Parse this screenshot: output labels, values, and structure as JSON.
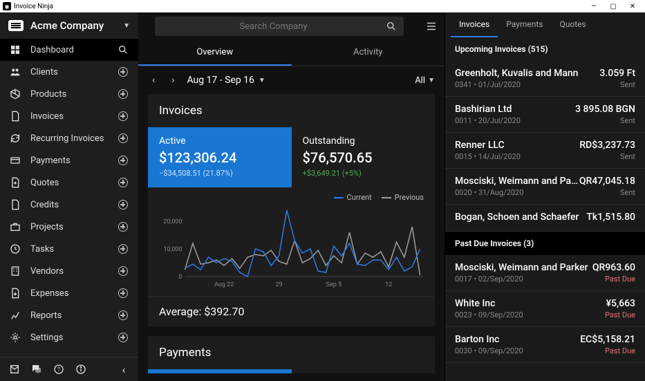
{
  "window": {
    "title": "Invoice Ninja"
  },
  "company": {
    "name": "Acme Company"
  },
  "nav": [
    {
      "label": "Dashboard",
      "icon": "dashboard",
      "trail": "search",
      "active": true
    },
    {
      "label": "Clients",
      "icon": "people",
      "trail": "plus"
    },
    {
      "label": "Products",
      "icon": "cube",
      "trail": "plus"
    },
    {
      "label": "Invoices",
      "icon": "file",
      "trail": "plus"
    },
    {
      "label": "Recurring Invoices",
      "icon": "refresh",
      "trail": "plus"
    },
    {
      "label": "Payments",
      "icon": "card",
      "trail": "plus"
    },
    {
      "label": "Quotes",
      "icon": "file-plus",
      "trail": "plus"
    },
    {
      "label": "Credits",
      "icon": "file",
      "trail": "plus"
    },
    {
      "label": "Projects",
      "icon": "briefcase",
      "trail": "plus"
    },
    {
      "label": "Tasks",
      "icon": "clock",
      "trail": "plus"
    },
    {
      "label": "Vendors",
      "icon": "building",
      "trail": "plus"
    },
    {
      "label": "Expenses",
      "icon": "file-down",
      "trail": "plus"
    },
    {
      "label": "Reports",
      "icon": "chart",
      "trail": "plus"
    },
    {
      "label": "Settings",
      "icon": "gear",
      "trail": "plus"
    }
  ],
  "search": {
    "placeholder": "Search Company"
  },
  "main_tabs": {
    "overview": "Overview",
    "activity": "Activity"
  },
  "date_range": "Aug 17 - Sep 16",
  "filter_all": "All",
  "invoices_card": {
    "title": "Invoices",
    "active": {
      "label": "Active",
      "value": "$123,306.24",
      "delta": "−$34,508.51 (21.87%)"
    },
    "outstanding": {
      "label": "Outstanding",
      "value": "$76,570.65",
      "delta": "+$3,649.21 (+5%)"
    },
    "legend": {
      "current": "Current",
      "previous": "Previous"
    },
    "average_label": "Average: $392.70"
  },
  "payments_card": {
    "title": "Payments"
  },
  "rtabs": {
    "invoices": "Invoices",
    "payments": "Payments",
    "quotes": "Quotes"
  },
  "upcoming_header": "Upcoming Invoices (515)",
  "pastdue_header": "Past Due Invoices (3)",
  "upcoming": [
    {
      "client": "Greenholt, Kuvalis and Mann",
      "num": "0341",
      "date": "01/Jul/2020",
      "amount": "3.059 Ft",
      "status": "Sent"
    },
    {
      "client": "Bashirian Ltd",
      "num": "0011",
      "date": "20/Jul/2020",
      "amount": "3 895.08 BGN",
      "status": "Sent"
    },
    {
      "client": "Renner LLC",
      "num": "0015",
      "date": "14/Jul/2020",
      "amount": "RD$3,237.73",
      "status": "Sent"
    },
    {
      "client": "Mosciski, Weimann and Parker",
      "num": "0020",
      "date": "31/Aug/2020",
      "amount": "QR47,045.18",
      "status": "Sent"
    },
    {
      "client": "Bogan, Schoen and Schaefer",
      "num": "",
      "date": "",
      "amount": "Tk1,515.80",
      "status": ""
    }
  ],
  "pastdue": [
    {
      "client": "Mosciski, Weimann and Parker",
      "num": "0017",
      "date": "02/Sep/2020",
      "amount": "QR963.60",
      "status": "Past Due"
    },
    {
      "client": "White Inc",
      "num": "0023",
      "date": "09/Sep/2020",
      "amount": "¥5,663",
      "status": "Past Due"
    },
    {
      "client": "Barton Inc",
      "num": "0030",
      "date": "09/Sep/2020",
      "amount": "EC$5,158.21",
      "status": "Past Due"
    }
  ],
  "chart_data": {
    "type": "line",
    "title": "Invoices",
    "ylabel": "",
    "ylim": [
      0,
      25000
    ],
    "yticks": [
      0,
      10000,
      20000
    ],
    "x_labels": [
      "Aug 22",
      "29",
      "Sep 5",
      "12"
    ],
    "x_label_positions": [
      5,
      12,
      19,
      26
    ],
    "series": [
      {
        "name": "Current",
        "color": "#2d7be5",
        "values": [
          3000,
          4500,
          2500,
          7000,
          5000,
          6500,
          5500,
          1500,
          0,
          10000,
          9000,
          4000,
          7500,
          24000,
          13000,
          8500,
          10000,
          2000,
          1500,
          11000,
          7500,
          12000,
          4500,
          4000,
          6000,
          6000,
          2500,
          7000,
          2000,
          3500,
          10000
        ]
      },
      {
        "name": "Previous",
        "color": "#9e9e9e",
        "values": [
          2500,
          12000,
          4500,
          5000,
          6000,
          4000,
          6500,
          3000,
          7000,
          8000,
          7500,
          9500,
          5500,
          4500,
          13000,
          5000,
          6500,
          9500,
          4000,
          7500,
          5000,
          16000,
          4500,
          8500,
          7000,
          9000,
          3500,
          12500,
          7000,
          18000,
          500
        ]
      }
    ]
  }
}
